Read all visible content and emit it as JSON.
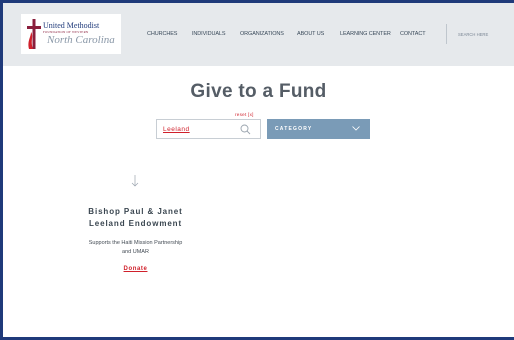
{
  "logo": {
    "line1": "United Methodist",
    "line2": "FOUNDATION OF WESTERN",
    "line3": "North Carolina",
    "cross_color": "#8a1e3c",
    "flame_color": "#d0202b"
  },
  "nav": {
    "items": [
      "CHURCHES",
      "INDIVIDUALS",
      "ORGANIZATIONS",
      "ABOUT US",
      "LEARNING CENTER",
      "CONTACT"
    ],
    "search_label": "SEARCH HERE"
  },
  "page": {
    "title": "Give to a Fund"
  },
  "filters": {
    "reset_label": "reset [x]",
    "search_value": "Leeland",
    "search_icon": "search-icon",
    "category_label": "CATEGORY",
    "category_icon": "chevron-down-icon"
  },
  "fund": {
    "icon": "arrow-down-icon",
    "title_line1": "Bishop Paul & Janet",
    "title_line2": "Leeland Endowment",
    "desc_line1": "Supports the Haiti Mission Partnership",
    "desc_line2": "and UMAR",
    "donate_label": "Donate"
  },
  "colors": {
    "accent_red": "#d0202b",
    "category_blue": "#7a9bb7",
    "header_bg": "#e6e9ec",
    "frame_blue": "#1f3a7a"
  }
}
